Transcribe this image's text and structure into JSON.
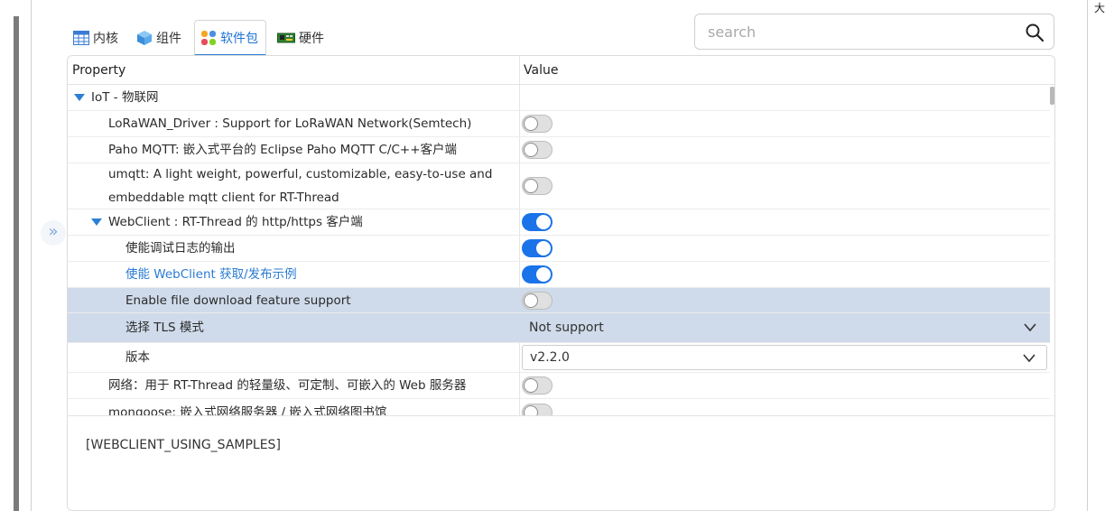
{
  "tabs": [
    {
      "label": "内核",
      "icon": "table-icon",
      "active": false
    },
    {
      "label": "组件",
      "icon": "cube-icon",
      "active": false
    },
    {
      "label": "软件包",
      "icon": "package-icon",
      "active": true
    },
    {
      "label": "硬件",
      "icon": "board-icon",
      "active": false
    }
  ],
  "search": {
    "placeholder": "search",
    "value": ""
  },
  "table": {
    "headers": {
      "property": "Property",
      "value": "Value"
    },
    "rows": [
      {
        "label": "IoT - 物联网",
        "level": 0,
        "expanded": true,
        "type": "group"
      },
      {
        "label": "LoRaWAN_Driver : Support for LoRaWAN Network(Semtech)",
        "level": 1,
        "type": "toggle",
        "on": false
      },
      {
        "label": "Paho MQTT: 嵌入式平台的 Eclipse Paho MQTT C/C++客户端",
        "level": 1,
        "type": "toggle",
        "on": false
      },
      {
        "label": "umqtt: A light weight, powerful, customizable, easy-to-use and",
        "label2": "embeddable mqtt client for RT-Thread",
        "level": 1,
        "type": "toggle",
        "on": false
      },
      {
        "label": "WebClient : RT-Thread 的 http/https 客户端",
        "level": 1,
        "expanded": true,
        "type": "toggle",
        "on": true
      },
      {
        "label": "使能调试日志的输出",
        "level": 2,
        "type": "toggle",
        "on": true
      },
      {
        "label": "使能 WebClient 获取/发布示例",
        "level": 2,
        "type": "toggle",
        "on": true,
        "highlight": true
      },
      {
        "label": "Enable file download feature support",
        "level": 2,
        "type": "toggle",
        "on": false,
        "selected": true
      },
      {
        "label": "选择 TLS 模式",
        "level": 2,
        "type": "select",
        "value": "Not support",
        "selected": true
      },
      {
        "label": "版本",
        "level": 2,
        "type": "select",
        "value": "v2.2.0"
      },
      {
        "label": "网络：用于 RT-Thread 的轻量级、可定制、可嵌入的 Web 服务器",
        "level": 1,
        "type": "toggle",
        "on": false
      },
      {
        "label": "mongoose: 嵌入式网络服务器 / 嵌入式网络图书馆",
        "level": 1,
        "type": "toggle",
        "on": false
      }
    ]
  },
  "description": "[WEBCLIENT_USING_SAMPLES]",
  "right_edge_text": "大",
  "colors": {
    "accent": "#1a73e8",
    "selected_row": "#cfdbea",
    "link": "#2a7bd3"
  }
}
